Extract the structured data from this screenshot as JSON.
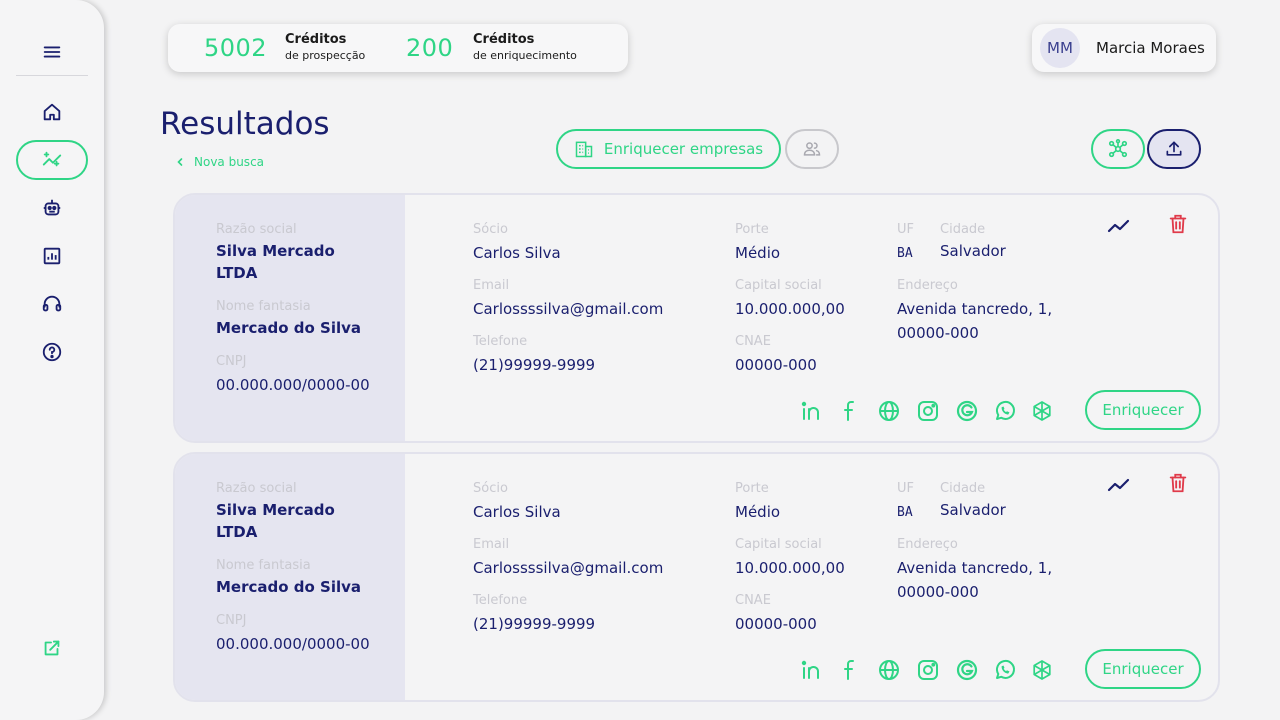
{
  "credits": {
    "prospect_value": "5002",
    "prospect_title": "Créditos",
    "prospect_sub": "de prospecção",
    "enrich_value": "200",
    "enrich_title": "Créditos",
    "enrich_sub": "de enriquecimento"
  },
  "user": {
    "initials": "MM",
    "name": "Marcia Moraes"
  },
  "page": {
    "title": "Resultados",
    "back_link": "Nova busca"
  },
  "toolbar": {
    "enrich_companies_label": "Enriquecer empresas"
  },
  "labels": {
    "razao": "Razão social",
    "fantasia": "Nome fantasia",
    "cnpj": "CNPJ",
    "socio": "Sócio",
    "email": "Email",
    "telefone": "Telefone",
    "porte": "Porte",
    "capital": "Capital social",
    "cnae": "CNAE",
    "uf": "UF",
    "cidade": "Cidade",
    "endereco": "Endereço",
    "enrich_button": "Enriquecer"
  },
  "results": [
    {
      "razao_line1": "Silva Mercado",
      "razao_line2": "LTDA",
      "fantasia": "Mercado do Silva",
      "cnpj": "00.000.000/0000-00",
      "socio": "Carlos Silva",
      "email": "Carlossssilva@gmail.com",
      "telefone": "(21)99999-9999",
      "porte": "Médio",
      "capital": "10.000.000,00",
      "cnae": "00000-000",
      "uf": "BA",
      "cidade": "Salvador",
      "endereco_line1": "Avenida tancredo, 1,",
      "endereco_line2": "00000-000"
    },
    {
      "razao_line1": "Silva Mercado",
      "razao_line2": "LTDA",
      "fantasia": "Mercado do Silva",
      "cnpj": "00.000.000/0000-00",
      "socio": "Carlos Silva",
      "email": "Carlossssilva@gmail.com",
      "telefone": "(21)99999-9999",
      "porte": "Médio",
      "capital": "10.000.000,00",
      "cnae": "00000-000",
      "uf": "BA",
      "cidade": "Salvador",
      "endereco_line1": "Avenida tancredo, 1,",
      "endereco_line2": "00000-000"
    }
  ],
  "colors": {
    "accent_green": "#2fd586",
    "navy": "#1a1f6e",
    "danger_red": "#e03a4a",
    "muted_label": "#c9c9d0"
  },
  "icons": {
    "sidebar": [
      "menu-icon",
      "home-icon",
      "search-sparkle-icon",
      "robot-icon",
      "report-icon",
      "headset-icon",
      "help-icon",
      "external-link-icon"
    ],
    "card_actions": [
      "trend-icon",
      "trash-icon"
    ],
    "social": [
      "linkedin-icon",
      "facebook-icon",
      "website-icon",
      "instagram-icon",
      "google-icon",
      "whatsapp-icon",
      "openai-icon"
    ]
  }
}
